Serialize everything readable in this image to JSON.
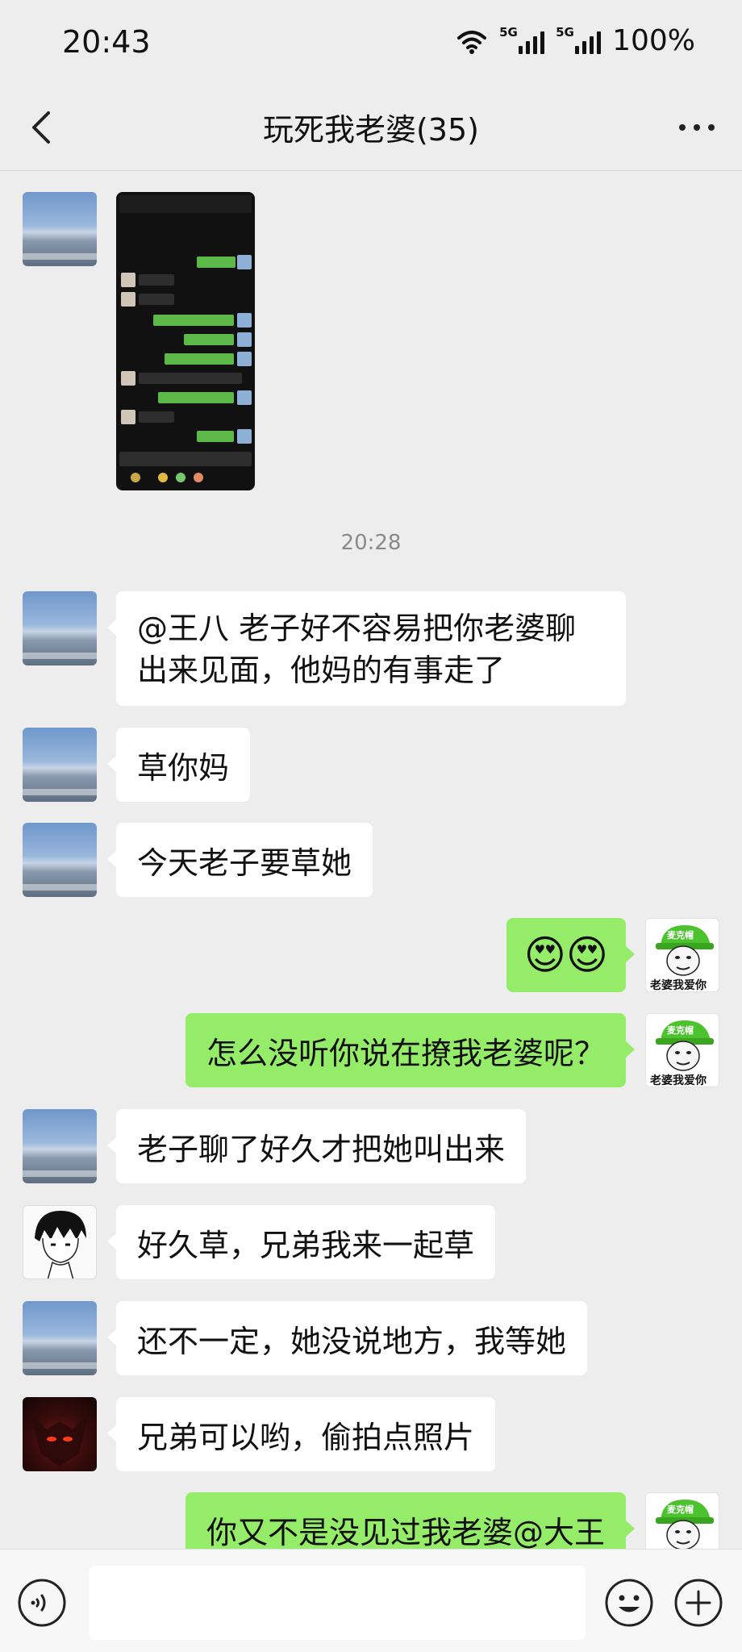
{
  "status_bar": {
    "time": "20:43",
    "net1": "5G",
    "net2": "5G",
    "battery": "100%"
  },
  "header": {
    "title": "玩死我老婆(35)",
    "back_icon": "chevron-left-icon",
    "more_icon": "more-dots-icon"
  },
  "chat": {
    "timestamp": "20:28",
    "messages": [
      {
        "side": "in",
        "type": "image"
      },
      {
        "side": "in",
        "text": "@王八 老子好不容易把你老婆聊出来见面，他妈的有事走了"
      },
      {
        "side": "in",
        "text": "草你妈"
      },
      {
        "side": "in",
        "text": "今天老子要草她"
      },
      {
        "side": "out",
        "text": "😍😍"
      },
      {
        "side": "out",
        "text": "怎么没听你说在撩我老婆呢？"
      },
      {
        "side": "in",
        "text": "老子聊了好久才把她叫出来"
      },
      {
        "side": "in",
        "text": "好久草，兄弟我来一起草"
      },
      {
        "side": "in",
        "text": "还不一定，她没说地方，我等她"
      },
      {
        "side": "in",
        "text": "兄弟可以哟，偷拍点照片"
      },
      {
        "side": "out",
        "text": "你又不是没见过我老婆@大王"
      }
    ],
    "my_avatar": {
      "hat": "麦克帽",
      "caption": "老婆我爱你"
    }
  },
  "bottom_bar": {
    "voice_icon": "voice-icon",
    "emoji_icon": "emoji-icon",
    "plus_icon": "plus-icon",
    "input_value": ""
  },
  "colors": {
    "background": "#ededed",
    "bubble_out": "#95ec69",
    "bubble_in": "#ffffff"
  }
}
